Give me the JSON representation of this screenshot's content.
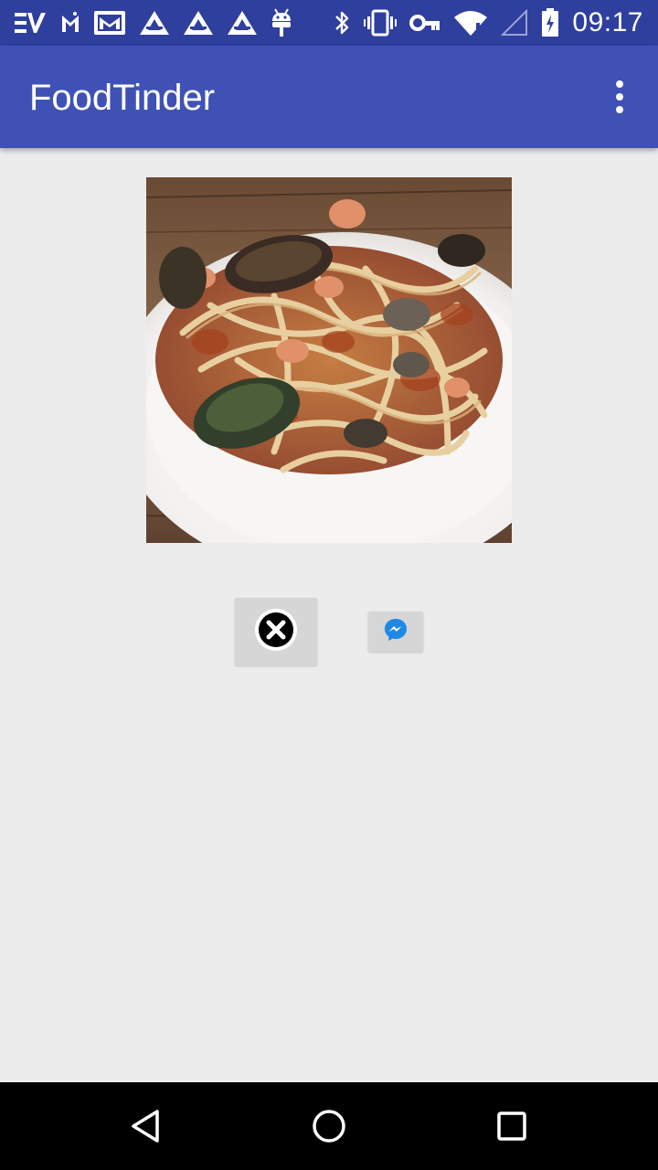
{
  "status_bar": {
    "time": "09:17",
    "left_icons": [
      "ev-app-icon",
      "gmail-icon",
      "email-icon",
      "app-a-icon",
      "app-a-icon",
      "app-a-icon",
      "android-debug-icon"
    ],
    "right_icons": [
      "bluetooth-icon",
      "vibrate-icon",
      "vpn-key-icon",
      "wifi-icon",
      "signal-icon",
      "battery-charging-icon"
    ]
  },
  "app_bar": {
    "title": "FoodTinder",
    "overflow_icon": "more-vert-icon"
  },
  "card": {
    "image_subject": "seafood fettuccine with mussels and clams",
    "dismiss_icon": "close-circle-icon",
    "share_icon": "messenger-icon"
  },
  "nav_bar": {
    "back_icon": "back-triangle-icon",
    "home_icon": "home-circle-icon",
    "recents_icon": "recents-square-icon"
  },
  "colors": {
    "status_bar": "#2f3f9e",
    "app_bar": "#3f51b5",
    "background": "#ececec",
    "button_bg": "#d6d6d6",
    "messenger_blue": "#1e88e5",
    "nav_bar": "#000000"
  }
}
